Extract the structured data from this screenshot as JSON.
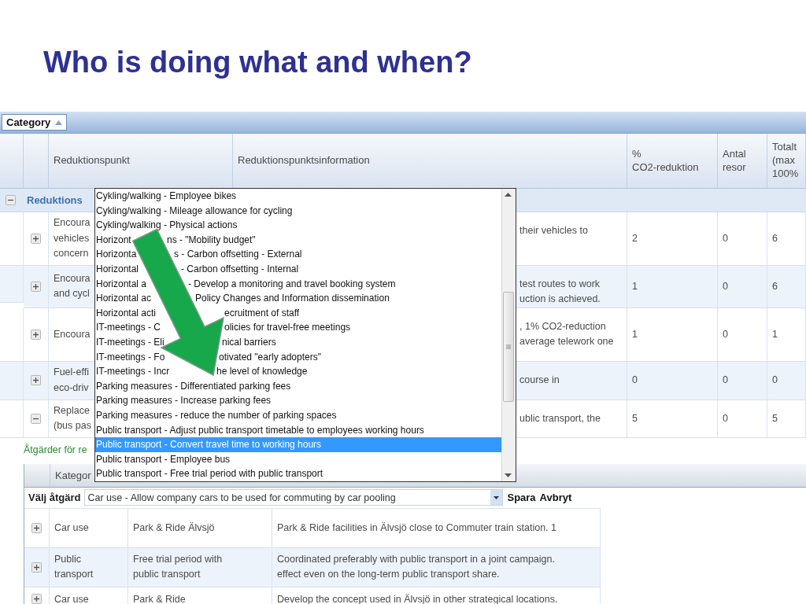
{
  "slide_title": "Who is doing what and when?",
  "group_by": {
    "label": "Category"
  },
  "table": {
    "columns": [
      "Reduktionspunkt",
      "Reduktionspunktsinformation",
      "%\nCO2-reduktion",
      "Antal\nresor",
      "Totalt\n(max\n100%"
    ],
    "group": {
      "label": "Reduktions",
      "expanded": true
    },
    "rows": [
      {
        "expanded": false,
        "punkt": "Encoura\nvehicles\nconcern",
        "info": "their vehicles to",
        "co2": "2",
        "antal": "0",
        "totalt": "6"
      },
      {
        "expanded": false,
        "punkt": "Encoura\nand cycl",
        "info": "test routes to work\nuction is achieved.",
        "co2": "1",
        "antal": "0",
        "totalt": "6"
      },
      {
        "expanded": false,
        "punkt": "Encoura",
        "info": ", 1% CO2-reduction\naverage telework one",
        "co2": "1",
        "antal": "0",
        "totalt": "1"
      },
      {
        "expanded": false,
        "punkt": "Fuel-effi\neco-driv",
        "info": "course in",
        "co2": "0",
        "antal": "0",
        "totalt": "0"
      },
      {
        "expanded": true,
        "punkt": "Replace\n(bus pas",
        "info": "ublic transport, the",
        "co2": "5",
        "antal": "0",
        "totalt": "5"
      }
    ]
  },
  "dropdown_list": [
    {
      "text": "Cykling/walking - Employee bikes",
      "selected": false
    },
    {
      "text": "Cykling/walking - Mileage allowance for cycling",
      "selected": false
    },
    {
      "text": "Cykling/walking - Physical actions",
      "selected": false
    },
    {
      "text": "Horizont",
      "text_after_arrow": "ns - \"Mobility budget\"",
      "selected": false
    },
    {
      "text": "Horizonta",
      "text_after_arrow": "s - Carbon offsetting - External",
      "selected": false
    },
    {
      "text": "Horizontal",
      "text_after_arrow": " - Carbon offsetting - Internal",
      "selected": false
    },
    {
      "text": "Horizontal a",
      "text_after_arrow": "- Develop a monitoring and travel booking system",
      "selected": false
    },
    {
      "text": "Horizontal ac",
      "text_after_arrow": "Policy Changes and Information dissemination",
      "selected": false
    },
    {
      "text": "Horizontal acti",
      "text_after_arrow": "ecruitment of staff",
      "selected": false
    },
    {
      "text": "IT-meetings - C",
      "text_after_arrow": "olicies for travel-free meetings",
      "selected": false
    },
    {
      "text": "IT-meetings - Eli",
      "text_after_arrow": "nical barriers",
      "selected": false
    },
    {
      "text": "IT-meetings - Fo",
      "text_after_arrow": "otivated \"early adopters\"",
      "selected": false
    },
    {
      "text": "IT-meetings - Incr",
      "text_after_arrow": "he level of knowledge",
      "selected": false
    },
    {
      "text": "Parking measures - Differentiated parking fees",
      "selected": false
    },
    {
      "text": "Parking measures - Increase parking fees",
      "selected": false
    },
    {
      "text": "Parking measures - reduce the number of parking spaces",
      "selected": false
    },
    {
      "text": "Public transport - Adjust public transport timetable to employees working hours",
      "selected": false
    },
    {
      "text": "Public transport - Convert travel time to working hours",
      "selected": true
    },
    {
      "text": "Public transport - Employee bus",
      "selected": false
    },
    {
      "text": "Public transport - Free trial period with public transport",
      "selected": false
    }
  ],
  "actions_section": {
    "heading": "Åtgärder för re",
    "header": "Kategor",
    "choose_label": "Välj åtgärd",
    "select": {
      "value": "Car use - Allow company cars to be used for commuting by car pooling"
    },
    "buttons": [
      "Spara",
      "Avbryt"
    ],
    "rows": [
      {
        "expanded": false,
        "category": "Car use",
        "name": "Park & Ride Älvsjö",
        "info": "Park & Ride facilities in Älvsjö close to Commuter train station. 1"
      },
      {
        "expanded": false,
        "category": "Public\ntransport",
        "name": "Free trial period with\npublic transport",
        "info": "Coordinated preferably with public transport in a joint campaign.\neffect even on the long-term public transport share."
      },
      {
        "expanded": false,
        "category": "Car use",
        "name": "Park & Ride",
        "info": "Develop the concept used in Älvsjö in other strategical locations."
      }
    ]
  }
}
